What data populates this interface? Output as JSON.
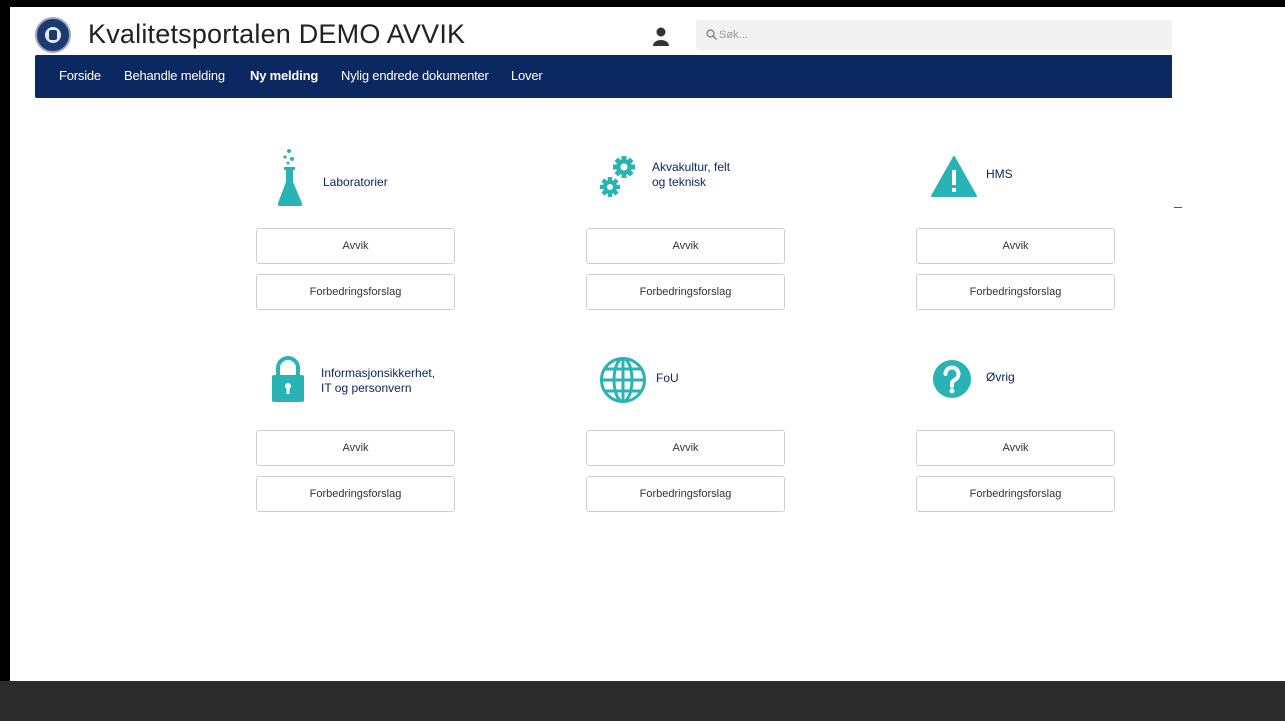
{
  "header": {
    "title": "Kvalitetsportalen DEMO AVVIK",
    "logo": "institution-seal",
    "user_icon": "user-icon",
    "search": {
      "placeholder": "Søk...",
      "value": "",
      "icon": "search-icon"
    }
  },
  "nav": {
    "items": [
      {
        "label": "Forside",
        "active": false
      },
      {
        "label": "Behandle melding",
        "active": false
      },
      {
        "label": "Ny melding",
        "active": true
      },
      {
        "label": "Nylig endrede dokumenter",
        "active": false
      },
      {
        "label": "Lover",
        "active": false
      }
    ]
  },
  "categories": [
    {
      "label": "Laboratorier",
      "icon": "flask-icon",
      "buttons": [
        "Avvik",
        "Forbedringsforslag"
      ]
    },
    {
      "label": "Akvakultur, felt\nog teknisk",
      "icon": "gears-icon",
      "buttons": [
        "Avvik",
        "Forbedringsforslag"
      ]
    },
    {
      "label": "HMS",
      "icon": "warning-triangle-icon",
      "buttons": [
        "Avvik",
        "Forbedringsforslag"
      ]
    },
    {
      "label": "Informasjonsikkerhet,\nIT og personvern",
      "icon": "lock-icon",
      "buttons": [
        "Avvik",
        "Forbedringsforslag"
      ]
    },
    {
      "label": "FoU",
      "icon": "globe-icon",
      "buttons": [
        "Avvik",
        "Forbedringsforslag"
      ]
    },
    {
      "label": "Øvrig",
      "icon": "question-circle-icon",
      "buttons": [
        "Avvik",
        "Forbedringsforslag"
      ]
    }
  ],
  "colors": {
    "navbar": "#0c2860",
    "icon_teal": "#2ab3b4",
    "label": "#0c2860"
  }
}
